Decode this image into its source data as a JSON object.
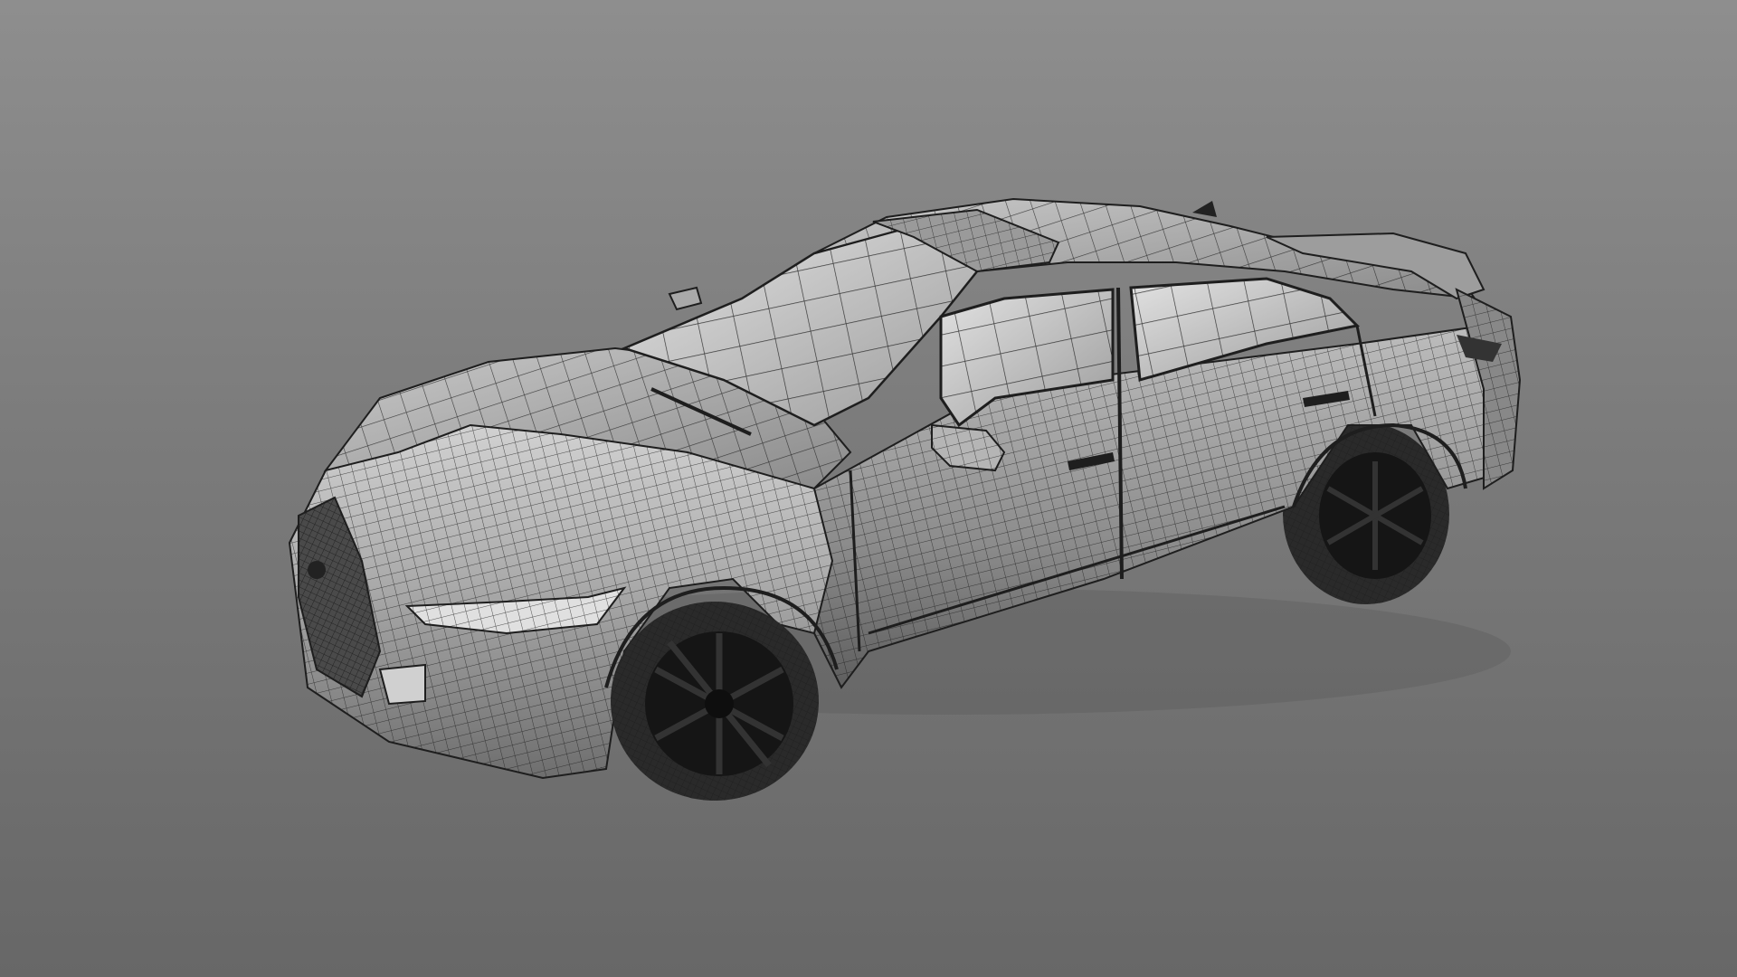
{
  "scene": {
    "object": "car-wireframe-model",
    "shading": "wireframe-on-shaded",
    "colors": {
      "background_top": "#8e8e8e",
      "background_bottom": "#676767",
      "surface_light": "#d2d2d2",
      "surface_mid": "#a8a8a8",
      "surface_dark": "#6a6a6a",
      "wire": "#1e1e1e",
      "tire": "#2a2a2a",
      "rim": "#151515"
    }
  }
}
